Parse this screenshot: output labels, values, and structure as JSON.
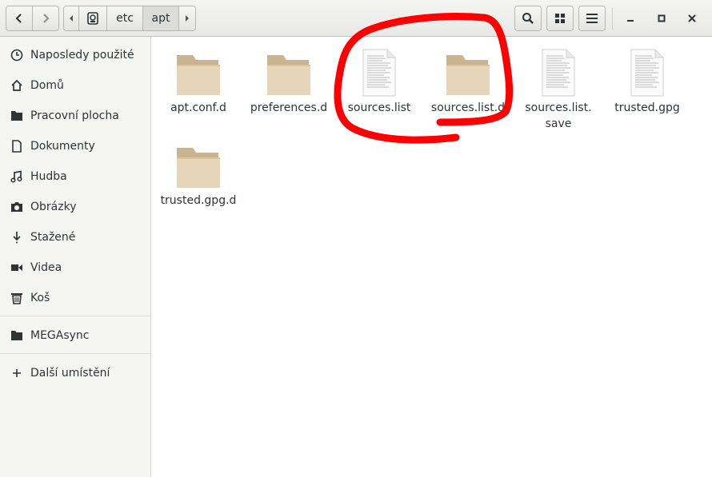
{
  "header": {
    "pathbar": {
      "root_icon": "drive-icon",
      "segments": [
        {
          "label": "etc",
          "active": false
        },
        {
          "label": "apt",
          "active": true
        }
      ]
    },
    "buttons": {
      "back": "chevron-left-icon",
      "forward": "chevron-right-icon",
      "search": "search-icon",
      "view": "grid-view-icon",
      "menu": "hamburger-menu-icon",
      "minimize": "minimize-icon",
      "maximize": "maximize-icon",
      "close": "close-icon"
    }
  },
  "sidebar": {
    "items": [
      {
        "label": "Naposledy použité",
        "icon": "recent-clock-icon"
      },
      {
        "label": "Domů",
        "icon": "home-icon"
      },
      {
        "label": "Pracovní plocha",
        "icon": "desktop-folder-icon"
      },
      {
        "label": "Dokumenty",
        "icon": "document-icon"
      },
      {
        "label": "Hudba",
        "icon": "music-icon"
      },
      {
        "label": "Obrázky",
        "icon": "camera-icon"
      },
      {
        "label": "Stažené",
        "icon": "download-icon"
      },
      {
        "label": "Videa",
        "icon": "video-icon"
      },
      {
        "label": "Koš",
        "icon": "trash-icon"
      }
    ],
    "bookmarks": [
      {
        "label": "MEGAsync",
        "icon": "folder-icon"
      }
    ],
    "other": {
      "label": "Další umístění",
      "icon": "plus-icon"
    }
  },
  "files": [
    {
      "name": "apt.conf.d",
      "type": "folder"
    },
    {
      "name": "preferences.d",
      "type": "folder"
    },
    {
      "name": "sources.list",
      "type": "file"
    },
    {
      "name": "sources.list.d",
      "type": "folder"
    },
    {
      "name": "sources.list.\nsave",
      "type": "file"
    },
    {
      "name": "trusted.gpg",
      "type": "file"
    },
    {
      "name": "trusted.gpg.d",
      "type": "folder"
    }
  ],
  "colors": {
    "annotation": "#ff0000",
    "folder_tab": "#c9b48f",
    "folder_body": "#e6d5b8"
  }
}
